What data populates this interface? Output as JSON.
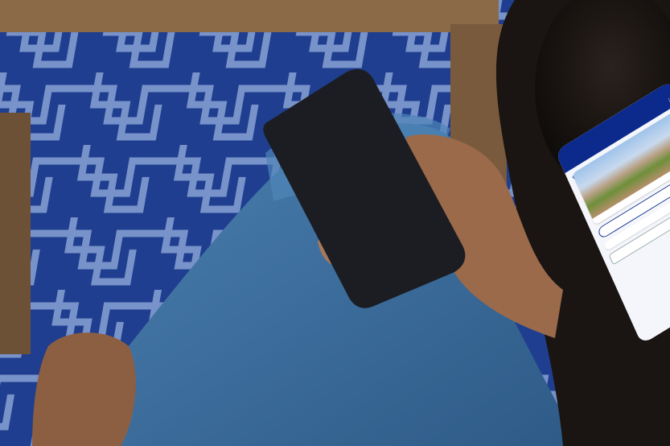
{
  "scene": {
    "description_colors": {
      "rug_blue": "#1f3e8f",
      "jeans_blue": "#3d6f9e",
      "skin": "#9a6a4a",
      "app_header": "#0b2a8c"
    }
  },
  "phone": {
    "app_header_title": "",
    "notice_text": "",
    "card_city": "",
    "card_price": "",
    "button_label": "",
    "chat_text": ""
  }
}
